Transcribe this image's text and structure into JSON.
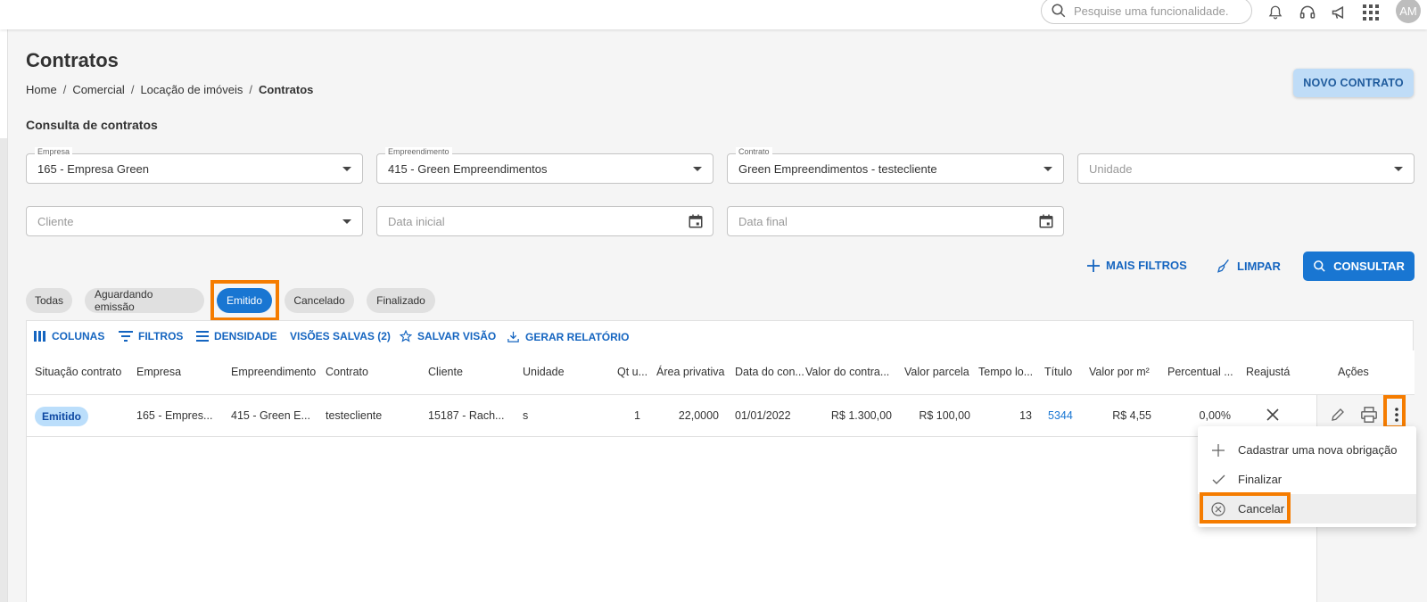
{
  "header": {
    "search_placeholder": "Pesquise uma funcionalidade.",
    "avatar_initials": "AM"
  },
  "page": {
    "title": "Contratos",
    "breadcrumb": [
      "Home",
      "Comercial",
      "Locação de imóveis",
      "Contratos"
    ],
    "new_button": "NOVO CONTRATO",
    "subtitle": "Consulta de contratos"
  },
  "filters": {
    "empresa": {
      "label": "Empresa",
      "value": "165 - Empresa Green"
    },
    "empreendimento": {
      "label": "Empreendimento",
      "value": "415 - Green Empreendimentos"
    },
    "contrato": {
      "label": "Contrato",
      "value": "Green Empreendimentos - testecliente"
    },
    "unidade": {
      "placeholder": "Unidade"
    },
    "cliente": {
      "placeholder": "Cliente"
    },
    "data_inicial": {
      "placeholder": "Data inicial"
    },
    "data_final": {
      "placeholder": "Data final"
    }
  },
  "actions": {
    "mais_filtros": "MAIS FILTROS",
    "limpar": "LIMPAR",
    "consultar": "CONSULTAR"
  },
  "status_chips": [
    {
      "label": "Todas",
      "active": false
    },
    {
      "label": "Aguardando emissão",
      "active": false
    },
    {
      "label": "Emitido",
      "active": true
    },
    {
      "label": "Cancelado",
      "active": false
    },
    {
      "label": "Finalizado",
      "active": false
    }
  ],
  "grid_toolbar": {
    "colunas": "COLUNAS",
    "filtros": "FILTROS",
    "densidade": "DENSIDADE",
    "visoes_salvas": "VISÕES SALVAS (2)",
    "salvar_visao": "SALVAR VISÃO",
    "gerar_relatorio": "GERAR RELATÓRIO"
  },
  "table": {
    "columns": [
      "Situação contrato",
      "Empresa",
      "Empreendimento",
      "Contrato",
      "Cliente",
      "Unidade",
      "Qt u...",
      "Área privativa",
      "Data do con...",
      "Valor do contra...",
      "Valor parcela",
      "Tempo lo...",
      "Título",
      "Valor por m²",
      "Percentual ...",
      "Reajustá",
      "Ações"
    ],
    "rows": [
      {
        "situacao": "Emitido",
        "empresa": "165 - Empres...",
        "empreendimento": "415 - Green E...",
        "contrato": "testecliente",
        "cliente": "15187 - Rach...",
        "unidade": "s",
        "qt": "1",
        "area": "22,0000",
        "data": "01/01/2022",
        "valor_contrato": "R$ 1.300,00",
        "valor_parcela": "R$ 100,00",
        "tempo": "13",
        "titulo": "5344",
        "valor_m2": "R$ 4,55",
        "percentual": "0,00%"
      }
    ]
  },
  "context_menu": {
    "items": [
      "Cadastrar uma nova obrigação",
      "Finalizar",
      "Cancelar"
    ]
  },
  "colors": {
    "primary": "#1976d2",
    "highlight": "#f57c00",
    "badge_bg": "#bbdefb"
  }
}
